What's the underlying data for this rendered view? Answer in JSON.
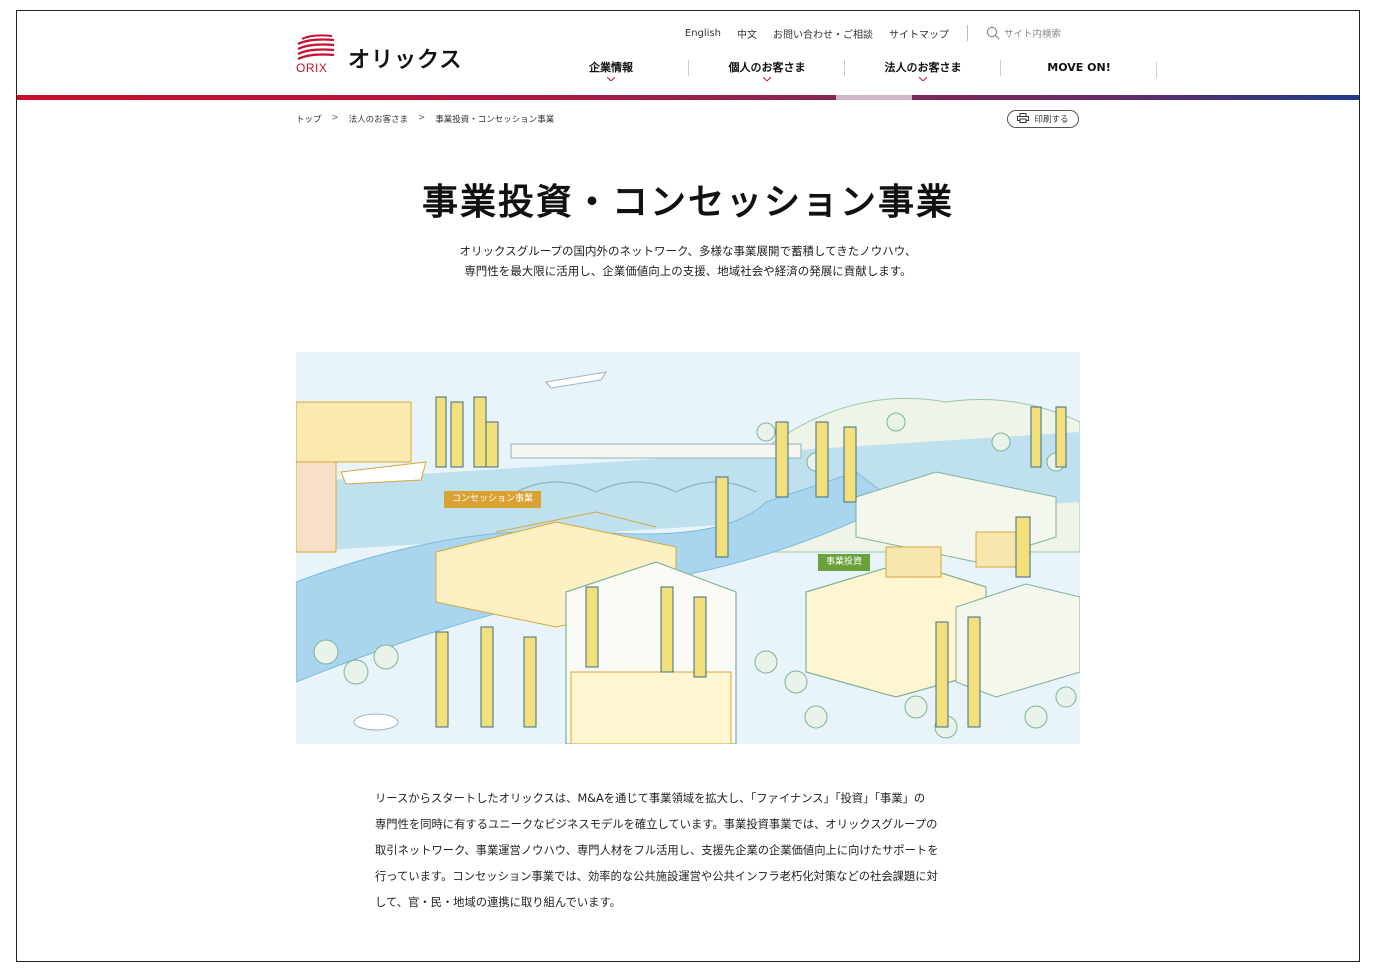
{
  "header": {
    "logo_word": "ORIX",
    "logo_jp": "オリックス",
    "utility": [
      {
        "label": "English"
      },
      {
        "label": "中文"
      },
      {
        "label": "お問い合わせ・ご相談"
      },
      {
        "label": "サイトマップ"
      }
    ],
    "search_placeholder": "サイト内検索",
    "nav": [
      {
        "label": "企業情報"
      },
      {
        "label": "個人のお客さま"
      },
      {
        "label": "法人のお客さま"
      },
      {
        "label": "MOVE ON!"
      }
    ]
  },
  "breadcrumb": {
    "items": [
      "トップ",
      "法人のお客さま",
      "事業投資・コンセッション事業"
    ],
    "separator": ">"
  },
  "print_label": "印刷する",
  "page": {
    "title": "事業投資・コンセッション事業",
    "lead_line1": "オリックスグループの国内外のネットワーク、多様な事業展開で蓄積してきたノウハウ、",
    "lead_line2": "専門性を最大限に活用し、企業価値向上の支援、地域社会や経済の発展に貢献します。"
  },
  "hero": {
    "tag_concession": "コンセッション事業",
    "tag_invest": "事業投資"
  },
  "body": {
    "line1": "リースからスタートしたオリックスは、M&Aを通じて事業領域を拡大し、「ファイナンス」「投資」「事業」の",
    "line2": "専門性を同時に有するユニークなビジネスモデルを確立しています。事業投資事業では、オリックスグループの",
    "line3": "取引ネットワーク、事業運営ノウハウ、専門人材をフル活用し、支援先企業の企業価値向上に向けたサポートを",
    "line4": "行っています。コンセッション事業では、効率的な公共施設運営や公共インフラ老朽化対策などの社会課題に対",
    "line5": "して、官・民・地域の連携に取り組んでいます。"
  },
  "colors": {
    "brand_red": "#c8102e",
    "stripe_blue": "#1e3d8a",
    "tag_concession": "#d9a233",
    "tag_invest": "#6aa13a"
  }
}
